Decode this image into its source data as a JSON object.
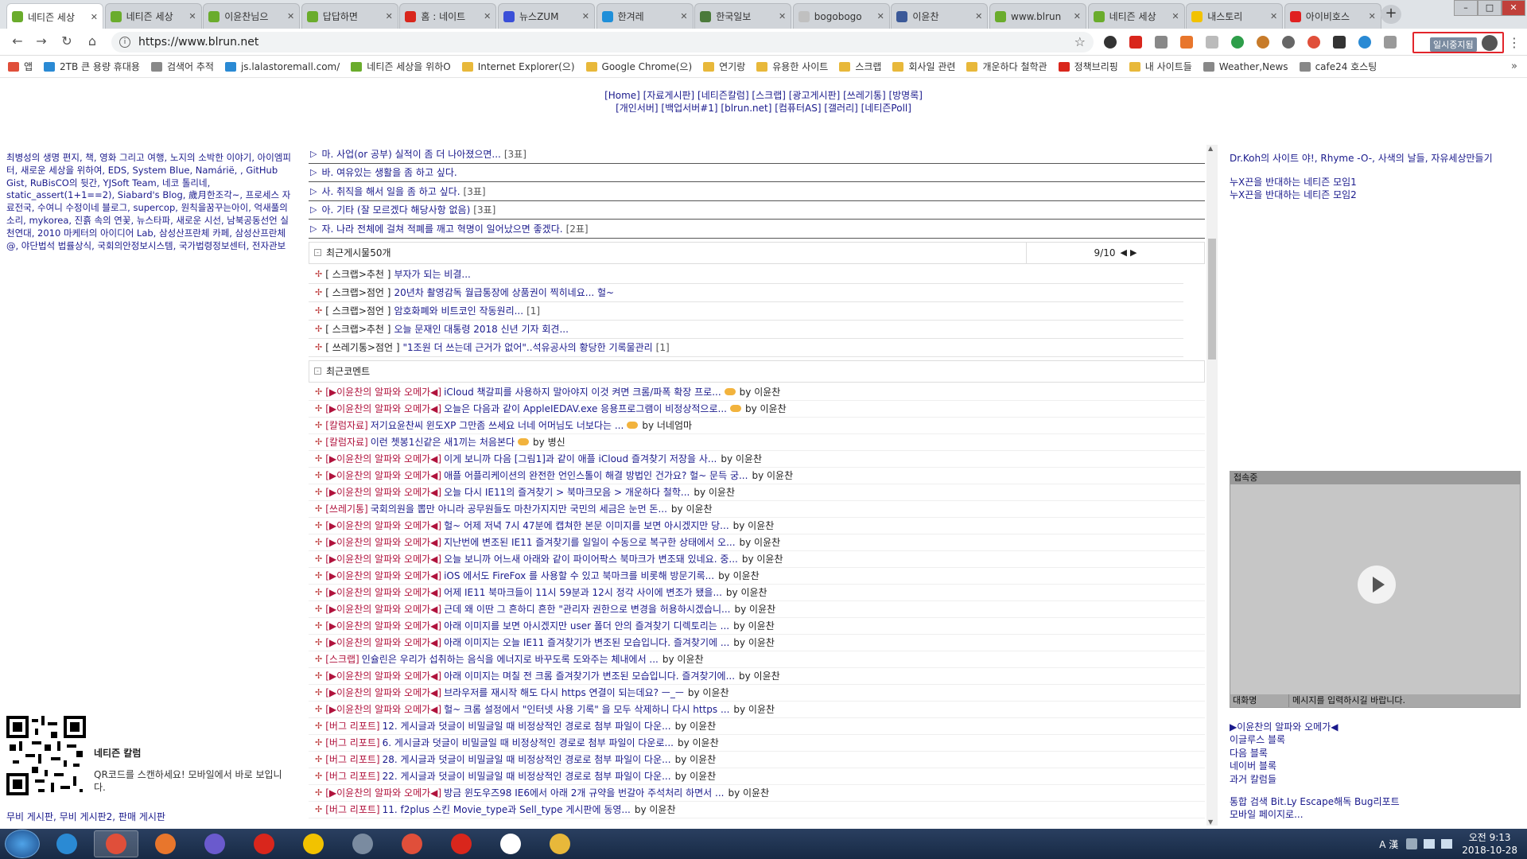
{
  "browser": {
    "tabs": [
      {
        "title": "네티즌 세상",
        "icon_color": "#6aac2c",
        "active": true
      },
      {
        "title": "네티즌 세상",
        "icon_color": "#6aac2c"
      },
      {
        "title": "이윤찬님으",
        "icon_color": "#6aac2c"
      },
      {
        "title": "답답하면",
        "icon_color": "#6aac2c"
      },
      {
        "title": "홈 : 네이트",
        "icon_color": "#d9261c"
      },
      {
        "title": "뉴스ZUM",
        "icon_color": "#3a4fd8"
      },
      {
        "title": "한겨레",
        "icon_color": "#1f8fd9"
      },
      {
        "title": "한국일보",
        "icon_color": "#4b7a3a"
      },
      {
        "title": "bogobogo",
        "icon_color": "#c0c0c0"
      },
      {
        "title": "이윤찬",
        "icon_color": "#3b5998"
      },
      {
        "title": "www.blrun",
        "icon_color": "#6aac2c"
      },
      {
        "title": "네티즌 세상",
        "icon_color": "#6aac2c"
      },
      {
        "title": "내스토리",
        "icon_color": "#f2c200"
      },
      {
        "title": "아이비호스",
        "icon_color": "#e02020"
      }
    ],
    "new_tab": "+",
    "window_buttons": [
      "–",
      "□",
      "✕"
    ],
    "nav": {
      "back": "←",
      "forward": "→",
      "reload": "↻",
      "home": "⌂"
    },
    "address": {
      "info_icon": "i",
      "url": "https://www.blrun.net",
      "star": "☆"
    },
    "profile": {
      "label": "일시중지됨"
    },
    "menu_icon": "⋮",
    "bookmarks": [
      {
        "label": "앱",
        "color": "#e04f3a"
      },
      {
        "label": "2TB 큰 용량 휴대용",
        "color": "#2a8ad4"
      },
      {
        "label": "검색어 추적",
        "color": "#888"
      },
      {
        "label": "js.lalastoremall.com/",
        "color": "#2a8ad4"
      },
      {
        "label": "네티즌 세상을 위하O",
        "color": "#6aac2c"
      },
      {
        "label": "Internet Explorer(으)",
        "color": "#e8b83a"
      },
      {
        "label": "Google Chrome(으)",
        "color": "#e8b83a"
      },
      {
        "label": "연기랑",
        "color": "#e8b83a"
      },
      {
        "label": "유용한 사이트",
        "color": "#e8b83a"
      },
      {
        "label": "스크랩",
        "color": "#e8b83a"
      },
      {
        "label": "회사일 관련",
        "color": "#e8b83a"
      },
      {
        "label": "개운하다 철학관",
        "color": "#e8b83a"
      },
      {
        "label": "정책브리핑",
        "color": "#d9261c"
      },
      {
        "label": "내 사이트들",
        "color": "#e8b83a"
      },
      {
        "label": "Weather,News",
        "color": "#888"
      },
      {
        "label": "cafe24 호스팅",
        "color": "#888"
      }
    ],
    "bookmarks_more": "»"
  },
  "site": {
    "topnav_line1": "[Home] [자료게시판] [네티즌칼럼] [스크랩] [광고게시판] [쓰레기통] [방명록]",
    "topnav_line2": "[개인서버] [백업서버#1] [blrun.net] [컴퓨터AS] [갤러리] [네티즌Poll]",
    "left_links": "최병성의 생명 편지, 책, 영화 그리고 여행, 노지의 소박한 이야기, 아이엠피터, 새로운 세상을 위하여, EDS, System Blue, Namárië, , GitHub Gist, RuBisCO의 뒷간, YJSoft Team, 네코 톨리네, static_assert(1+1==2), Siabard's Blog, 歲月한조각~, 프로세스 자료전국, 수여니 수정이네 블로그, supercop, 원칙을꿈꾸는아이, 억새풀의 소리, mykorea, 진흙 속의 연꽃, 뉴스타파, 새로운 시선, 남북공동선언 실천연대, 2010 마케터의 아이디어 Lab, 삼성산프란체 카페, 삼성산프란체@, 야단법석 법률상식, 국회의안정보시스템, 국가법령정보센터, 전자관보",
    "qr": {
      "title": "네티즌 칼럼",
      "text": "QR코드를 스캔하세요! 모바일에서 바로 보입니다.",
      "links": "무비 게시판, 무비 게시판2, 판매 게시판"
    },
    "poll_rows": [
      {
        "text": "마. 사업(or 공부) 실적이 좀 더 나아졌으면...",
        "count": "[3표]"
      },
      {
        "text": "바. 여유있는 생활을 좀 하고 싶다.",
        "count": ""
      },
      {
        "text": "사. 취직을 해서 일을 좀 하고 싶다.",
        "count": "[3표]"
      },
      {
        "text": "아. 기타 (잘 모르겠다 해당사항 없음)",
        "count": "[3표]"
      },
      {
        "text": "자. 나라 전체에 걸쳐 적폐를 깨고 혁명이 일어났으면 좋겠다.",
        "count": "[2표]"
      }
    ],
    "recent_posts_title": "최근게시물50개",
    "recent_posts_page": "9/10",
    "prev_icon": "◀",
    "next_icon": "▶",
    "recent_posts": [
      {
        "cat": "[ 스크랩>추천 ]",
        "title": "부자가 되는 비결...",
        "count": ""
      },
      {
        "cat": "[ 스크랩>점언 ]",
        "title": "20년차 촬영감독 월급통장에 상품권이 찍히네요... 헐~",
        "count": ""
      },
      {
        "cat": "[ 스크랩>점언 ]",
        "title": "암호화폐와 비트코인 작동원리...",
        "count": "[1]"
      },
      {
        "cat": "[ 스크랩>추천 ]",
        "title": "오늘 문재인 대통령 2018 신년 기자 회견...",
        "count": ""
      },
      {
        "cat": "[ 쓰레기통>점언 ]",
        "title": "\"1조원 더 쓰는데 근거가 없어\"..석유공사의 황당한 기록물관리",
        "count": "[1]"
      }
    ],
    "recent_comments_title": "최근코멘트",
    "comments": [
      {
        "cat": "[▶이윤찬의 알파와 오메가◀]",
        "text": "iCloud 책갈피를 사용하지 말아야지 이것 켜면 크롬/파폭 확장 프로...",
        "icon": true,
        "by": "by 이윤찬"
      },
      {
        "cat": "[▶이윤찬의 알파와 오메가◀]",
        "text": "오늘은 다음과 같이 AppleIEDAV.exe 응용프로그램이 비정상적으로...",
        "icon": true,
        "by": "by 이윤찬"
      },
      {
        "cat": "[칼럼자료]",
        "text": "저기요윤찬씨 윈도XP 그만좀 쓰세요 너네 어머님도 너보다는 ...",
        "icon": true,
        "by": "by 너네엄마"
      },
      {
        "cat": "[칼럼자료]",
        "text": "이런 쳇봉1신같은 새1끼는 처음본다",
        "icon": true,
        "by": "by 병신"
      },
      {
        "cat": "[▶이윤찬의 알파와 오메가◀]",
        "text": "이게 보니까 다음 [그림1]과 같이 애플 iCloud 즐겨찾기 저장을 사...",
        "icon": false,
        "by": "by 이윤찬"
      },
      {
        "cat": "[▶이윤찬의 알파와 오메가◀]",
        "text": "애플 어플리케이션의 완전한 언인스톨이 해결 방법인 건가요? 헐~ 문득 궁...",
        "icon": false,
        "by": "by 이윤찬"
      },
      {
        "cat": "[▶이윤찬의 알파와 오메가◀]",
        "text": "오늘 다시 IE11의 즐겨찾기 > 북마크모음 > 개운하다 철학...",
        "icon": false,
        "by": "by 이윤찬"
      },
      {
        "cat": "[쓰레기통]",
        "text": "국회의원을 뽑만 아니라 공무원들도 마찬가지지만 국민의 세금은 눈먼 돈...",
        "icon": false,
        "by": "by 이윤찬"
      },
      {
        "cat": "[▶이윤찬의 알파와 오메가◀]",
        "text": "헐~ 어제 저녁 7시 47분에 캡쳐한 본문 이미지를 보면 아시겠지만 당...",
        "icon": false,
        "by": "by 이윤찬"
      },
      {
        "cat": "[▶이윤찬의 알파와 오메가◀]",
        "text": "지난번에 변조된 IE11 즐겨찾기를 일일이 수동으로 복구한 상태에서 오...",
        "icon": false,
        "by": "by 이윤찬"
      },
      {
        "cat": "[▶이윤찬의 알파와 오메가◀]",
        "text": "오늘 보니까 어느새 아래와 같이 파이어팍스 북마크가 변조돼 있네요. 중...",
        "icon": false,
        "by": "by 이윤찬"
      },
      {
        "cat": "[▶이윤찬의 알파와 오메가◀]",
        "text": "iOS 에서도 FireFox 를 사용할 수 있고 북마크를 비롯해 방문기록...",
        "icon": false,
        "by": "by 이윤찬"
      },
      {
        "cat": "[▶이윤찬의 알파와 오메가◀]",
        "text": "어제 IE11 북마크들이 11시 59분과 12시 정각 사이에 변조가 됐을...",
        "icon": false,
        "by": "by 이윤찬"
      },
      {
        "cat": "[▶이윤찬의 알파와 오메가◀]",
        "text": "근데 왜 이딴 그 흔하디 흔한 \"관리자 권한으로 변경을 허용하시겠습니...",
        "icon": false,
        "by": "by 이윤찬"
      },
      {
        "cat": "[▶이윤찬의 알파와 오메가◀]",
        "text": "아래 이미지를 보면 아시겠지만 user 폴더 안의 즐겨찾기 디렉토리는 ...",
        "icon": false,
        "by": "by 이윤찬"
      },
      {
        "cat": "[▶이윤찬의 알파와 오메가◀]",
        "text": "아래 이미지는 오늘 IE11 즐겨찾기가 변조된 모습입니다. 즐겨찾기에 ...",
        "icon": false,
        "by": "by 이윤찬"
      },
      {
        "cat": "[스크랩]",
        "text": "인슐린은 우리가 섭취하는 음식을 에너지로 바꾸도록 도와주는 체내에서 ...",
        "icon": false,
        "by": "by 이윤찬"
      },
      {
        "cat": "[▶이윤찬의 알파와 오메가◀]",
        "text": "아래 이미지는 며칠 전 크롬 즐겨찾기가 변조된 모습입니다. 즐겨찾기에...",
        "icon": false,
        "by": "by 이윤찬"
      },
      {
        "cat": "[▶이윤찬의 알파와 오메가◀]",
        "text": "브라우저를 재시작 해도 다시 https 연결이 되는데요? ㅡ_ㅡ",
        "icon": false,
        "by": "by 이윤찬"
      },
      {
        "cat": "[▶이윤찬의 알파와 오메가◀]",
        "text": "헐~ 크롬 설정에서 \"인터넷 사용 기록\" 을 모두 삭제하니 다시 https ...",
        "icon": false,
        "by": "by 이윤찬"
      },
      {
        "cat": "[버그 리포트]",
        "text": "12. 게시글과 덧글이 비밀글일 때 비정상적인 경로로 첨부 파일이 다운...",
        "icon": false,
        "by": "by 이윤찬"
      },
      {
        "cat": "[버그 리포트]",
        "text": "6. 게시글과 덧글이 비밀글일 때 비정상적인 경로로 첨부 파일이 다운로...",
        "icon": false,
        "by": "by 이윤찬"
      },
      {
        "cat": "[버그 리포트]",
        "text": "28. 게시글과 덧글이 비밀글일 때 비정상적인 경로로 첨부 파일이 다운...",
        "icon": false,
        "by": "by 이윤찬"
      },
      {
        "cat": "[버그 리포트]",
        "text": "22. 게시글과 덧글이 비밀글일 때 비정상적인 경로로 첨부 파일이 다운...",
        "icon": false,
        "by": "by 이윤찬"
      },
      {
        "cat": "[▶이윤찬의 알파와 오메가◀]",
        "text": "방금 윈도우즈98 IE6에서 아래 2개 규약을 번갈아 주석처리 하면서 ...",
        "icon": false,
        "by": "by 이윤찬"
      },
      {
        "cat": "[버그 리포트]",
        "text": "11. f2plus 스킨 Movie_type과 Sell_type 게시판에 동영...",
        "icon": false,
        "by": "by 이윤찬"
      }
    ],
    "right_top": {
      "line1": "Dr.Koh의 사이트 야!, Rhyme -O-, 사색의 날들, 자유세상만들기",
      "line2": "누X끈을 반대하는 네티즌 모임1",
      "line3": "누X끈을 반대하는 네티즌 모임2"
    },
    "chat": {
      "header": "접속중",
      "footer_left": "대화명",
      "footer_right": "메시지를 입력하시길 바랍니다."
    },
    "right_links": [
      "▶이윤찬의 알파와 오메가◀",
      "이글루스 블록",
      "다음 블록",
      "네이버 블록",
      "과거 칼럼들"
    ],
    "right_links2": [
      "통합 검색 Bit.Ly Escape해독 Bug리포트",
      "모바일 페이지로..."
    ]
  },
  "taskbar": {
    "apps": [
      {
        "name": "ie-icon",
        "color": "#2a8ad4"
      },
      {
        "name": "chrome-icon",
        "color": "#e04f3a",
        "active": true
      },
      {
        "name": "firefox-icon",
        "color": "#e8762c"
      },
      {
        "name": "app-s-icon",
        "color": "#6a5acd"
      },
      {
        "name": "opera-icon",
        "color": "#d9261c"
      },
      {
        "name": "pen-app-icon",
        "color": "#f2c200"
      },
      {
        "name": "book-app-icon",
        "color": "#7a8ba0"
      },
      {
        "name": "daum-icon",
        "color": "#e04f3a"
      },
      {
        "name": "record-icon",
        "color": "#d9261c"
      },
      {
        "name": "network-app-icon",
        "color": "#ffffff"
      },
      {
        "name": "folder-icon",
        "color": "#e8b83a"
      }
    ],
    "clock_time": "오전 9:13",
    "clock_date": "2018-10-28",
    "tray_text": "A 漢"
  }
}
